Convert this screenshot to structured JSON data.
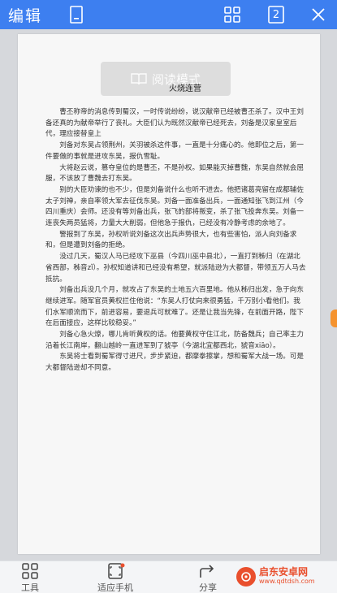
{
  "topbar": {
    "edit_label": "编辑",
    "bookmark_icon": "bookmark-icon",
    "grid_icon": "grid-icon",
    "page_count": "2",
    "close_icon": "close-icon",
    "accent_color": "#3d7ff0"
  },
  "document": {
    "reading_mode": "阅读模式",
    "title": "火烧连营",
    "paragraphs": [
      "曹丕称帝的消息传到蜀汉，一时传说纷纷，说汉献帝已经被曹丕杀了。汉中王刘备还真的为献帝举行了丧礼。大臣们认为既然汉献帝已经死去，刘备是汉家皇室后代，理应接替皇上",
      "刘备对东吴占领荆州，关羽被杀这件事，一直是十分痛心的。他即位之后，第一件要做的事就是进攻东吴，报仇雪耻。",
      "大将赵云说，篡夺皇位的是曹丕，不是孙权。如果能灭掉曹魏，东吴自然就会屈服，不该放了曹魏去打东吴。",
      "别的大臣劝谏的也不少，但是刘备说什么也听不进去。他把诸葛亮留在成都辅佐太子刘禅，亲自率领大军去征伐东吴。刘备一面准备出兵，一面通知张飞到江州（今四川重庆）会师。还没有等刘备出兵，张飞的部将叛变，杀了张飞投奔东吴。刘备一连丧失两员猛将，力量大大削弱，但他急于报仇，已经没有冷静考虑的余地了。",
      "警报到了东吴，孙权听说刘备这次出兵声势很大，也有些害怕，派人向刘备求和，但是遭到刘备的拒绝。",
      "没过几天，蜀汉人马已经攻下巫县（今四川巫中县北），一直打到秭归（在湖北省西部，秭音zǐ）。孙权知道讲和已经没有希望，就派陆逊为大都督，带领五万人马去抵抗。",
      "刘备出兵没几个月，就攻占了东吴的土地五六百里地。他从秭归出发，急于向东继续进军。随军官员黄权拦住他说：“东吴人打仗向来很勇猛，千万别小看他们。我们水军顺流而下，前进容易，要退兵可就难了。还是让我当先锋，在前面开路，陛下在后面接应，这样比较稳妥。”",
      "刘备心急火燎，哪儿肯听黄权的话。他要黄权守住江北，防备魏兵；自己率主力沿着长江南岸，翻山越岭一直进军到了猇亭（今湖北宜都西北，猇音xiāo）。",
      "东吴将士看到蜀军得寸进尺，步步紧迫，都摩拳擦掌，想和蜀军大战一场。可是大都督陆逊却不同意。"
    ]
  },
  "bottombar": {
    "tools_label": "工具",
    "fit_phone_label": "适应手机",
    "share_label": "分享",
    "tools_icon": "grid-icon",
    "fit_icon": "phone-fit-icon",
    "share_icon": "share-icon"
  },
  "watermark": {
    "cn": "启东安卓网",
    "en": "www.qdtdsh.com"
  }
}
